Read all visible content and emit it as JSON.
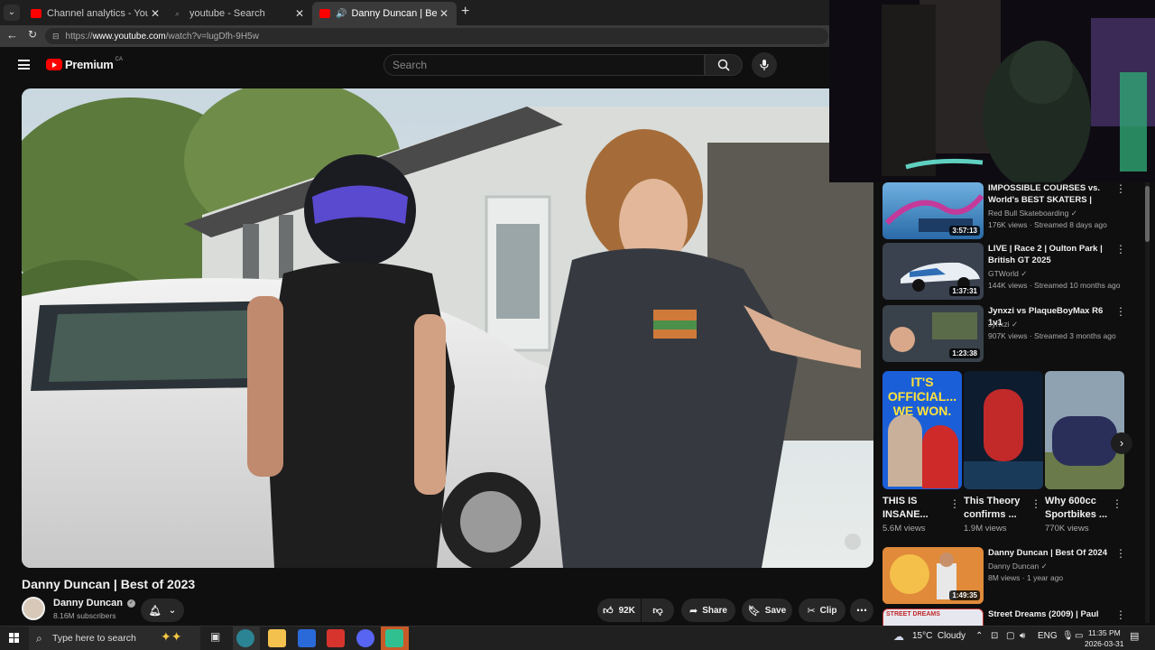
{
  "browser": {
    "tabs": [
      {
        "label": "Channel analytics - YouTube Studio",
        "active": false
      },
      {
        "label": "youtube - Search",
        "active": false
      },
      {
        "label": "Danny Duncan | Best of 2023",
        "active": true
      }
    ],
    "url_prefix": "https://",
    "url_domain": "www.youtube.com",
    "url_path": "/watch?v=lugDfh-9H5w"
  },
  "yt_header": {
    "logo": "Premium",
    "region": "CA",
    "search_placeholder": "Search"
  },
  "video": {
    "title": "Danny Duncan | Best of 2023",
    "channel": "Danny Duncan",
    "subscribers": "8.16M subscribers",
    "likes": "92K",
    "share_label": "Share",
    "save_label": "Save",
    "clip_label": "Clip"
  },
  "related": [
    {
      "title": "IMPOSSIBLE COURSES vs. World's BEST SKATERS | KASS...",
      "channel": "Red Bull Skateboarding",
      "meta": "176K views · Streamed 8 days ago",
      "duration": "3:57:13"
    },
    {
      "title": "LIVE | Race 2 | Oulton Park | British GT 2025",
      "channel": "GTWorld",
      "meta": "144K views · Streamed 10 months ago",
      "duration": "1:37:31"
    },
    {
      "title": "Jynxzi vs PlaqueBoyMax R6 1v1",
      "channel": "Jynxzi",
      "meta": "907K views · Streamed 3 months ago",
      "duration": "1:23:38"
    }
  ],
  "shorts": [
    {
      "title": "THIS IS INSANE...",
      "views": "5.6M views",
      "overlay": "IT'S OFFICIAL... WE WON."
    },
    {
      "title": "This Theory confirms ...",
      "views": "1.9M views"
    },
    {
      "title": "Why 600cc Sportbikes ...",
      "views": "770K views"
    }
  ],
  "related2": [
    {
      "title": "Danny Duncan | Best Of 2024",
      "channel": "Danny Duncan",
      "meta": "8M views · 1 year ago",
      "duration": "1:49:35"
    },
    {
      "title": "Street Dreams (2009) | Paul",
      "channel": "",
      "meta": "",
      "duration": ""
    }
  ],
  "taskbar": {
    "search_placeholder": "Type here to search",
    "weather": "15°C  Cloudy",
    "lang": "ENG",
    "time": "11:35 PM",
    "date": "2026-03-31"
  },
  "colors": {
    "yt_red": "#ff0000",
    "bg": "#0f0f0f",
    "verified": "#aaaaaa"
  }
}
